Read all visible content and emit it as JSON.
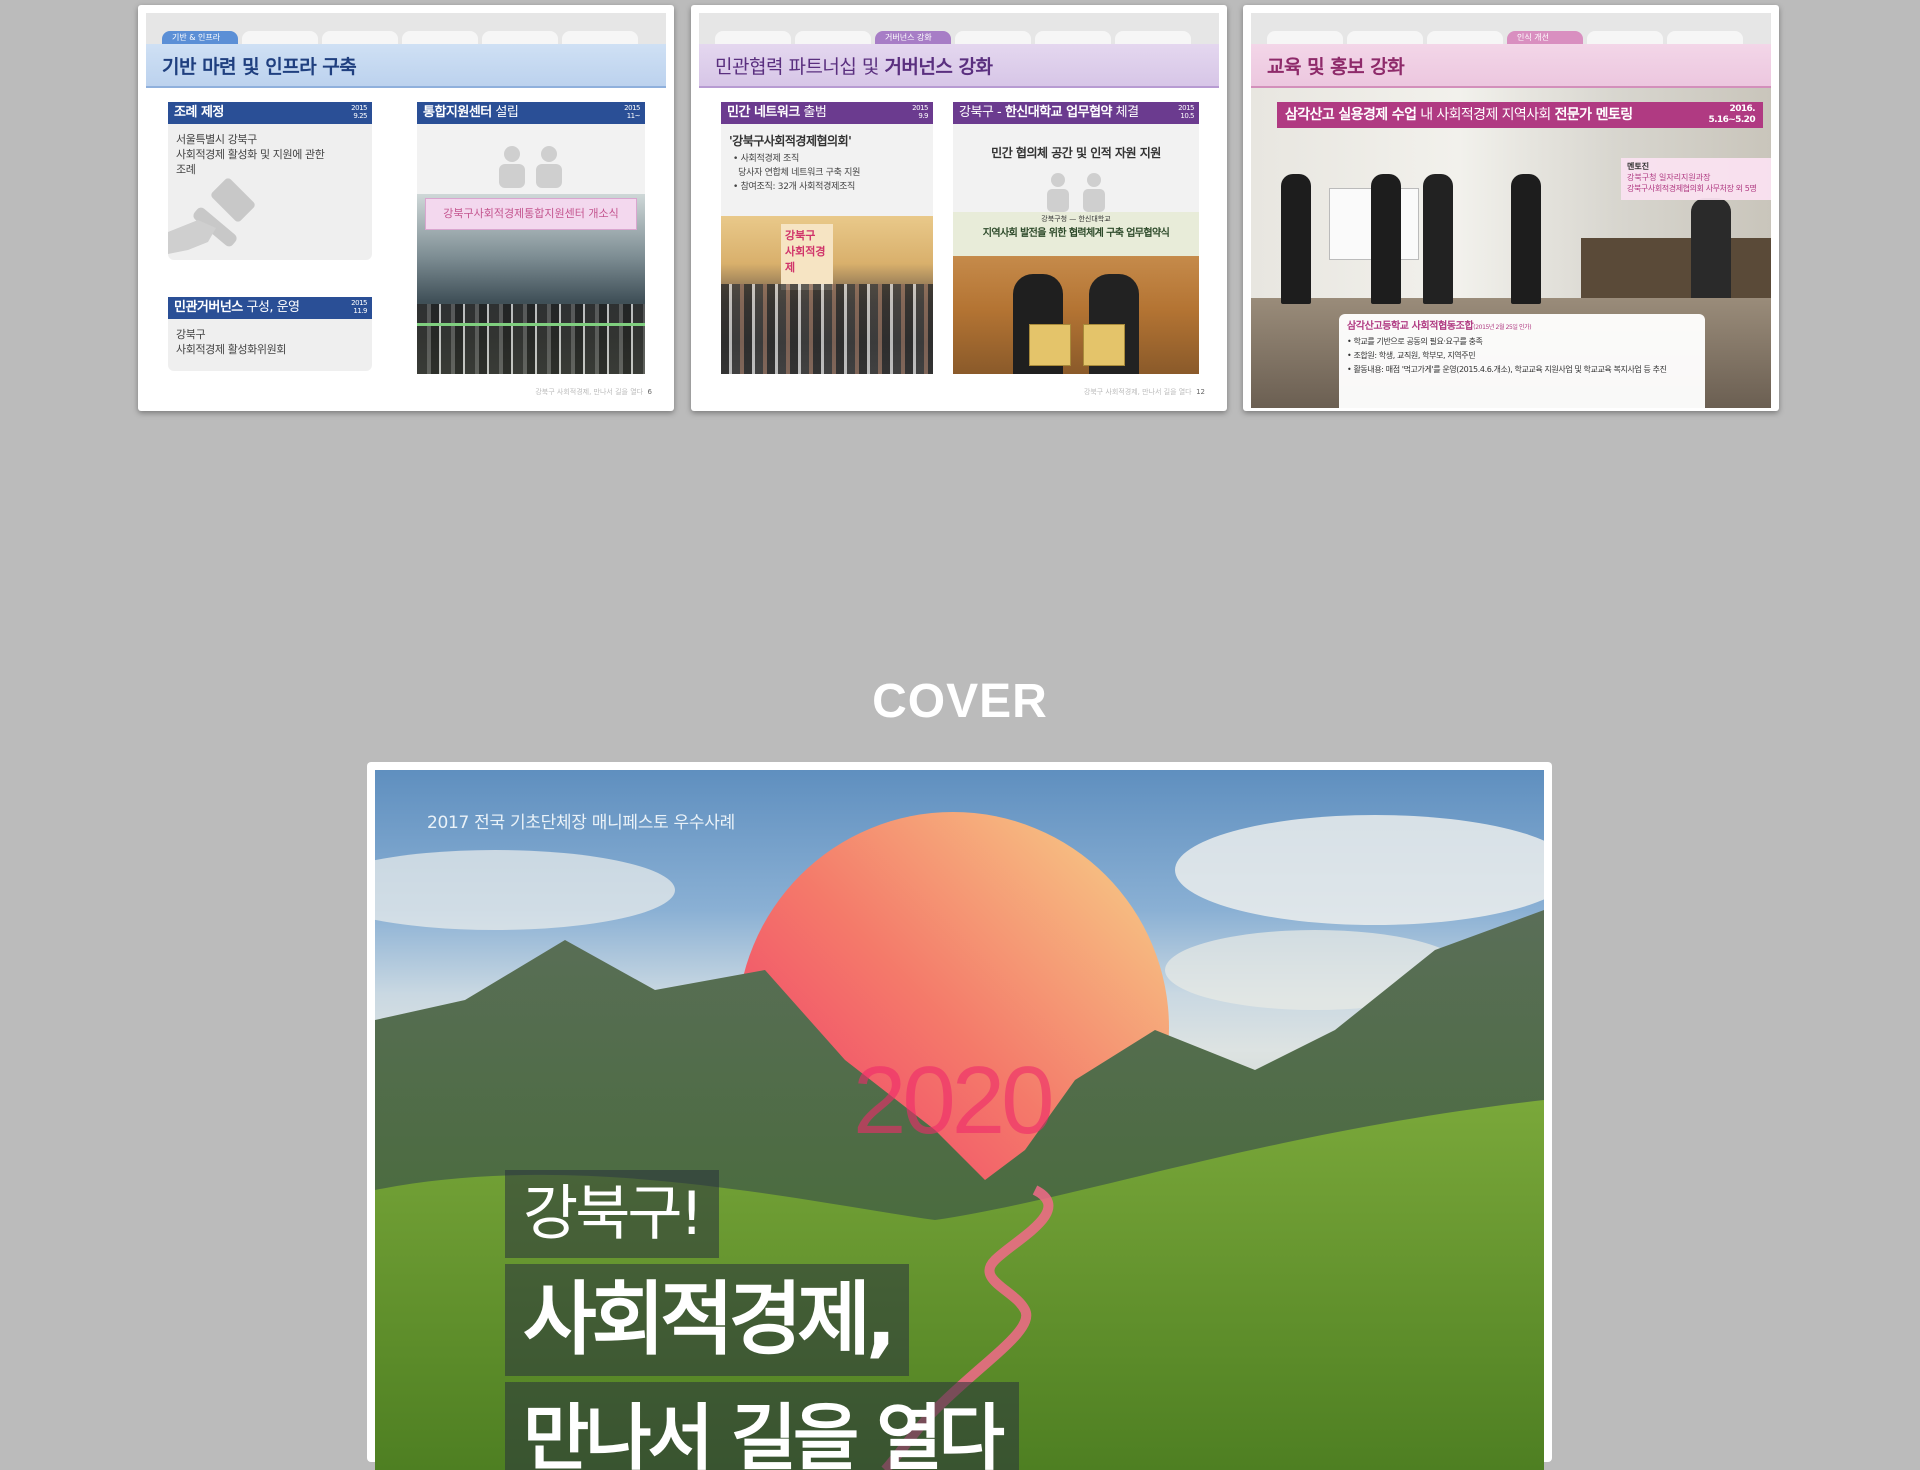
{
  "cards": [
    {
      "tabs": [
        "기반 & 인프라",
        "",
        "",
        "",
        "",
        ""
      ],
      "title": "기반 마련 및 인프라 구축",
      "boxes": {
        "ordinance": {
          "title": "조례 제정",
          "date1": "2015",
          "date2": "9.25",
          "lines": [
            "서울특별시 강북구",
            "사회적경제 활성화 및 지원에 관한",
            "조례"
          ]
        },
        "center": {
          "title_a": "통합지원센터",
          "title_b": " 설립",
          "date1": "2015",
          "date2": "11~",
          "banner": "강북구사회적경제통합지원센터 개소식"
        },
        "governance": {
          "title_a": "민관거버넌스",
          "title_b": " 구성, 운영",
          "date1": "2015",
          "date2": "11.9",
          "lines": [
            "강북구",
            "사회적경제 활성화위원회"
          ]
        }
      },
      "footer_text": "강북구 사회적경제, 만나서 길을 열다",
      "page": "6"
    },
    {
      "tabs": [
        "",
        "",
        "거버넌스 강화",
        "",
        "",
        ""
      ],
      "title_a": "민관협력 파트너십 및 ",
      "title_b": "거버넌스 강화",
      "boxes": {
        "network": {
          "title_a": "민간 네트워크",
          "title_b": " 출범",
          "date1": "2015",
          "date2": "9.9",
          "heading": "'강북구사회적경제협의회'",
          "lines": [
            "• 사회적경제 조직",
            "  당사자 연합체 네트워크 구축 지원",
            "• 참여조직: 32개 사회적경제조직"
          ],
          "sign": [
            "강북구",
            "사회적경제"
          ]
        },
        "mou": {
          "title_a": "강북구 - ",
          "title_b": "한신대학교 업무협약",
          "title_c": " 체결",
          "date1": "2015",
          "date2": "10.5",
          "heading": "민간 협의체 공간 및 인적 자원 지원",
          "banner_small": "강북구청 — 한신대학교",
          "banner": "지역사회 발전을 위한 협력체계 구축 업무협약식"
        }
      },
      "footer_text": "강북구 사회적경제, 만나서 길을 열다",
      "page": "12"
    },
    {
      "tabs": [
        "",
        "",
        "",
        "인식 개선",
        "",
        ""
      ],
      "title": "교육 및 홍보 강화",
      "banner": {
        "title_a": "삼각산고 실용경제 수업",
        "title_b": " 내 사회적경제 지역사회 ",
        "title_c": "전문가 멘토링",
        "date1": "2016.",
        "date2": "5.16~5.20"
      },
      "mentor": {
        "title": "멘토진",
        "lines": [
          "강북구청 일자리지원과장",
          "강북구사회적경제협의회 사무처장 외 5명"
        ]
      },
      "info": {
        "title": "삼각산고등학교 사회적협동조합",
        "title_note": "(2015년 2월 25일 인가)",
        "lines": [
          "• 학교를 기반으로 공동의 필요·요구를 충족",
          "• 조합원: 학생, 교직원, 학부모, 지역주민",
          "• 활동내용: 매점 '먹고가게'를 운영(2015.4.6.개소), 학교교육 지원사업 및 학교교육 복지사업 등 추진"
        ]
      }
    }
  ],
  "section_heading": "COVER",
  "cover": {
    "subtitle": "2017 전국 기초단체장 매니페스토 우수사례",
    "year": "2020",
    "line1": "강북구!",
    "line2": "사회적경제,",
    "line3": "만나서 길을 열다"
  },
  "colors": {
    "infra": "#2a4f96",
    "governance": "#6b3b8f",
    "education": "#b03a82"
  }
}
